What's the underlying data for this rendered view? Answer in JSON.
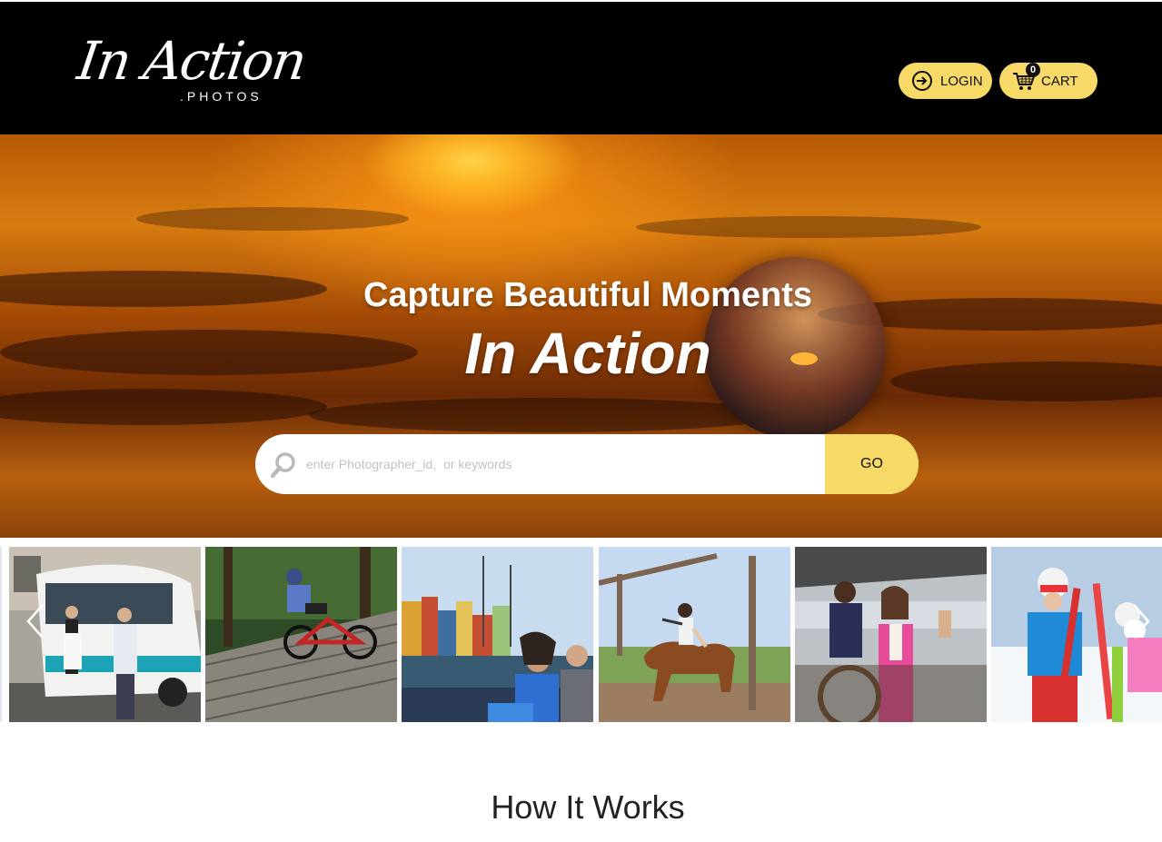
{
  "header": {
    "logo_script": "In Action",
    "logo_sub": ".PHOTOS",
    "login_label": "LOGIN",
    "cart_label": "CART",
    "cart_count": "0",
    "accent_color": "#f7d967"
  },
  "hero": {
    "title": "Capture Beautiful Moments",
    "subtitle": "In Action",
    "search_placeholder": "enter Photographer_id,  or keywords",
    "search_value": "",
    "go_label": "GO"
  },
  "carousel": {
    "slides": [
      {
        "icon": "photo-slide-bus-tour"
      },
      {
        "icon": "photo-slide-mountain-bike"
      },
      {
        "icon": "photo-slide-canal-boat"
      },
      {
        "icon": "photo-slide-horse-rider"
      },
      {
        "icon": "photo-slide-boat-wave"
      },
      {
        "icon": "photo-slide-skiers"
      }
    ]
  },
  "how_it_works": {
    "title": "How It Works"
  }
}
